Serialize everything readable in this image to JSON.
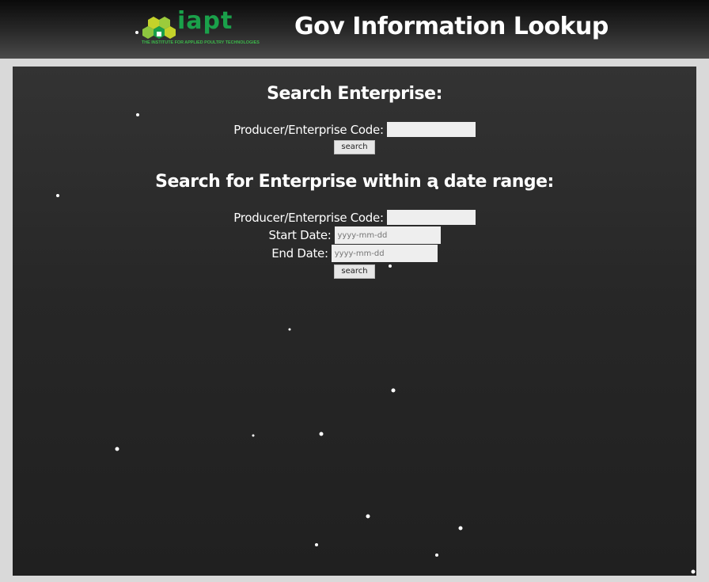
{
  "header": {
    "logo_text": "iapt",
    "logo_tagline": "THE INSTITUTE FOR APPLIED POULTRY TECHNOLOGIES",
    "title": "Gov Information Lookup"
  },
  "colors": {
    "header_bg": "#1a1a1a",
    "panel_bg": "#2b2b2b",
    "logo_green": "#1aa04a",
    "logo_lime": "#c4d22a",
    "page_bg": "#d9d9d9"
  },
  "search_enterprise": {
    "heading": "Search Enterprise:",
    "code_label": "Producer/Enterprise Code:",
    "code_value": "",
    "button_label": "search"
  },
  "search_range": {
    "heading": "Search for Enterprise within a date range:",
    "code_label": "Producer/Enterprise Code:",
    "code_value": "",
    "start_label": "Start Date:",
    "start_placeholder": "yyyy-mm-dd",
    "end_label": "End Date:",
    "end_placeholder": "yyyy-mm-dd",
    "button_label": "search"
  }
}
